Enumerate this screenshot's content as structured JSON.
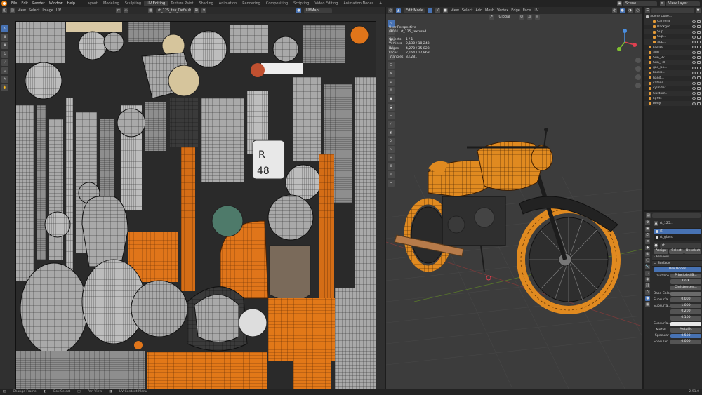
{
  "topbar": {
    "menus": [
      "File",
      "Edit",
      "Render",
      "Window",
      "Help"
    ],
    "workspaces": [
      "Layout",
      "Modeling",
      "Sculpting",
      "UV Editing",
      "Texture Paint",
      "Shading",
      "Animation",
      "Rendering",
      "Compositing",
      "Scripting",
      "Video Editing",
      "Animation Nodes"
    ],
    "add_workspace": "+",
    "scene": "Scene",
    "view_layer": "View Layer"
  },
  "uv_header": {
    "view": "View",
    "select": "Select",
    "image": "Image",
    "uv": "UV",
    "image_name": "rt_125_tex_Default...",
    "uvmap": "UVMap"
  },
  "viewport_header": {
    "mode": "Edit Mode",
    "view": "View",
    "select": "Select",
    "add": "Add",
    "mesh": "Mesh",
    "vertex": "Vertex",
    "edge": "Edge",
    "face": "Face",
    "uv": "UV",
    "orientation": "Global",
    "options": "Options"
  },
  "viewport_overlay": {
    "title": "User Perspective",
    "object": "(1001) rt_125_textured",
    "stats": [
      {
        "label": "Objects",
        "value": "1 / 1"
      },
      {
        "label": "Vertices",
        "value": "2,130 / 18,243"
      },
      {
        "label": "Edges",
        "value": "4,270 / 35,828"
      },
      {
        "label": "Faces",
        "value": "2,164 / 17,868"
      },
      {
        "label": "Triangles",
        "value": "33,281"
      }
    ]
  },
  "outliner": {
    "title": "Scene Colle...",
    "rows": [
      "Camera",
      "Backgro...",
      "Sup...",
      "Sup...",
      "Sup...",
      "Lights",
      "Sun",
      "Sun_Bk",
      "Sun_Fill",
      "gas_bo...",
      "backs...",
      "hand...",
      "cables",
      "cylinder",
      "Custom...",
      "lights",
      "body"
    ]
  },
  "properties": {
    "object_name": "rt_125...",
    "slots": [
      "rt",
      "rt_glass"
    ],
    "material_name": "rt",
    "buttons": [
      "Assign",
      "Select",
      "Deselect"
    ],
    "preview": "Preview",
    "surface_section": "Surface",
    "use_nodes": "Use Nodes",
    "surface_label": "Surface",
    "surface_value": "Principled B...",
    "distribution": "GGX",
    "subsurface_method": "Christensen...",
    "base_color": "Base Color",
    "subsurface": "Subsurfa...",
    "subsurface_value": "0.000",
    "subsurface_radius": "Subsurfa...",
    "radius_values": [
      "1.000",
      "0.200",
      "0.100"
    ],
    "subsurface_color": "Subsurfa...",
    "metallic": "Metall...",
    "metallic_value": "Metallic",
    "specular": "Specular",
    "specular_value": "0.500",
    "specular_tint": "Specular...",
    "specular_tint_value": "0.000"
  },
  "statusbar": {
    "items": [
      "Change Frame",
      "Box Select",
      "Pan View",
      "UV Context Menu"
    ],
    "version": "2.91.0"
  },
  "colors": {
    "accent": "#e87d0d",
    "selected_uv": "#e0751a",
    "active_blue": "#4772b3",
    "background": "#1d1d1d"
  }
}
